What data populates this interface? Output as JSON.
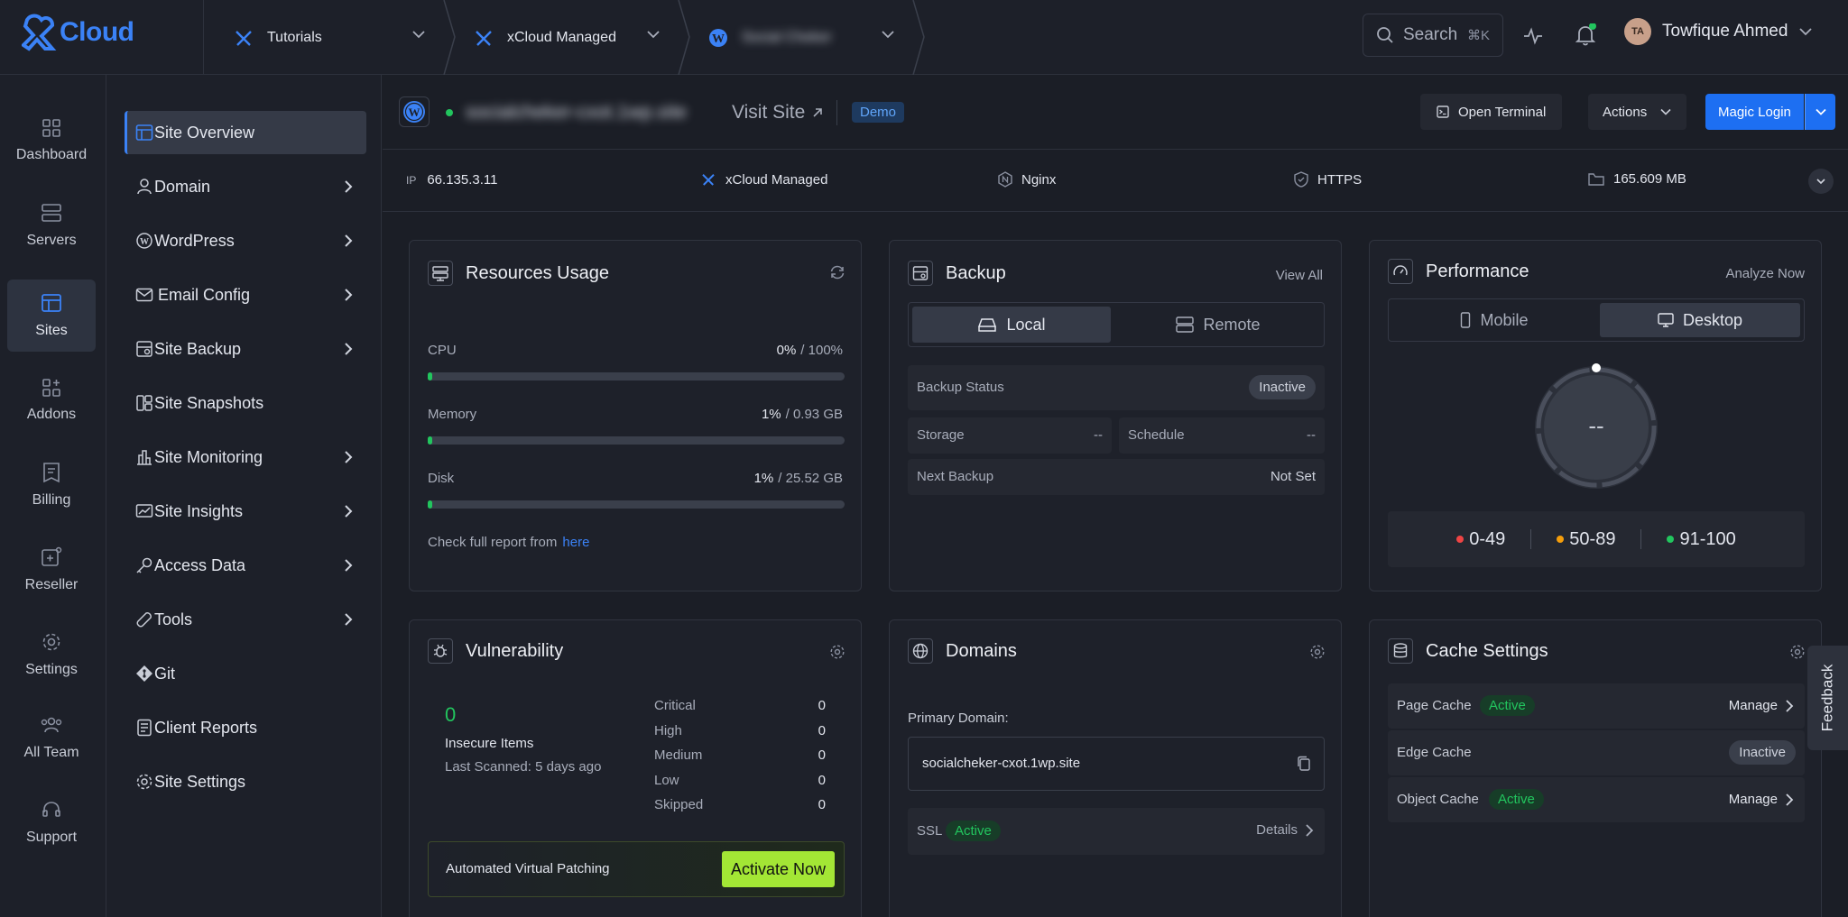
{
  "app": {
    "logo_text": "Cloud"
  },
  "breadcrumbs": [
    {
      "label": "Tutorials"
    },
    {
      "label": "xCloud Managed"
    },
    {
      "label": "Social Cheker"
    }
  ],
  "search": {
    "label": "Search",
    "shortcut": "⌘K"
  },
  "user": {
    "initials": "TA",
    "name": "Towfique Ahmed"
  },
  "rail": [
    {
      "label": "Dashboard",
      "icon": "dashboard-icon"
    },
    {
      "label": "Servers",
      "icon": "server-icon"
    },
    {
      "label": "Sites",
      "icon": "sites-icon",
      "active": true
    },
    {
      "label": "Addons",
      "icon": "addons-icon"
    },
    {
      "label": "Billing",
      "icon": "billing-icon"
    },
    {
      "label": "Reseller",
      "icon": "reseller-icon"
    },
    {
      "label": "Settings",
      "icon": "gear-icon"
    },
    {
      "label": "All Team",
      "icon": "team-icon"
    },
    {
      "label": "Support",
      "icon": "headset-icon"
    }
  ],
  "subnav": [
    {
      "label": "Site Overview",
      "active": true
    },
    {
      "label": "Domain",
      "has_children": true
    },
    {
      "label": "WordPress",
      "has_children": true
    },
    {
      "label": "Email Config",
      "has_children": true
    },
    {
      "label": "Site Backup",
      "has_children": true
    },
    {
      "label": "Site Snapshots"
    },
    {
      "label": "Site Monitoring",
      "has_children": true
    },
    {
      "label": "Site Insights",
      "has_children": true
    },
    {
      "label": "Access Data",
      "has_children": true
    },
    {
      "label": "Tools",
      "has_children": true
    },
    {
      "label": "Git"
    },
    {
      "label": "Client Reports"
    },
    {
      "label": "Site Settings"
    }
  ],
  "site": {
    "name": "socialcheker-cxot.1wp.site",
    "visit_label": "Visit Site",
    "tag": "Demo",
    "open_terminal": "Open Terminal",
    "actions": "Actions",
    "magic_login": "Magic Login"
  },
  "info": {
    "ip_label": "IP",
    "ip": "66.135.3.11",
    "provider": "xCloud Managed",
    "server": "Nginx",
    "protocol": "HTTPS",
    "size": "165.609 MB"
  },
  "resources": {
    "title": "Resources Usage",
    "cpu_label": "CPU",
    "cpu_pct": "0%",
    "cpu_total": "/ 100%",
    "cpu_fraction": 0.0,
    "mem_label": "Memory",
    "mem_pct": "1%",
    "mem_total": "/ 0.93 GB",
    "mem_fraction": 0.01,
    "disk_label": "Disk",
    "disk_pct": "1%",
    "disk_total": "/ 25.52 GB",
    "disk_fraction": 0.01,
    "report_text": "Check full report from",
    "report_link": "here"
  },
  "backup": {
    "title": "Backup",
    "view_all": "View All",
    "tab_local": "Local",
    "tab_remote": "Remote",
    "status_label": "Backup Status",
    "status_value": "Inactive",
    "storage_label": "Storage",
    "storage_value": "--",
    "schedule_label": "Schedule",
    "schedule_value": "--",
    "next_label": "Next Backup",
    "next_value": "Not Set"
  },
  "performance": {
    "title": "Performance",
    "analyze": "Analyze Now",
    "tab_mobile": "Mobile",
    "tab_desktop": "Desktop",
    "score": "--",
    "legend": [
      {
        "label": "0-49",
        "color": "#ef4444"
      },
      {
        "label": "50-89",
        "color": "#f59e0b"
      },
      {
        "label": "91-100",
        "color": "#22c55e"
      }
    ]
  },
  "vulnerability": {
    "title": "Vulnerability",
    "count": "0",
    "insecure_label": "Insecure Items",
    "last_scanned": "Last Scanned: 5 days ago",
    "levels": [
      {
        "label": "Critical",
        "value": "0"
      },
      {
        "label": "High",
        "value": "0"
      },
      {
        "label": "Medium",
        "value": "0"
      },
      {
        "label": "Low",
        "value": "0"
      },
      {
        "label": "Skipped",
        "value": "0"
      }
    ],
    "patching_label": "Automated Virtual Patching",
    "activate": "Activate Now"
  },
  "domains": {
    "title": "Domains",
    "primary_label": "Primary Domain:",
    "primary_value": "socialcheker-cxot.1wp.site",
    "ssl_label": "SSL",
    "ssl_status": "Active",
    "details": "Details"
  },
  "cache": {
    "title": "Cache Settings",
    "page_label": "Page Cache",
    "page_status": "Active",
    "page_action": "Manage",
    "edge_label": "Edge Cache",
    "edge_status": "Inactive",
    "object_label": "Object Cache",
    "object_status": "Active",
    "object_action": "Manage"
  },
  "feedback": "Feedback",
  "colors": {
    "accent": "#3b82f6",
    "success": "#22c55e",
    "lime": "#a3e635"
  }
}
